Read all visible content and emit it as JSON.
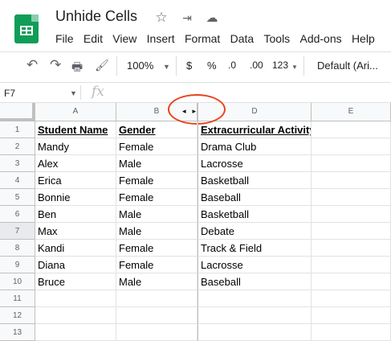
{
  "doc_title": "Unhide Cells",
  "menu": [
    "File",
    "Edit",
    "View",
    "Insert",
    "Format",
    "Data",
    "Tools",
    "Add-ons",
    "Help"
  ],
  "toolbar": {
    "undo": "↶",
    "redo": "↷",
    "print": "🖶",
    "paint": "🖌",
    "zoom": "100%",
    "currency": "$",
    "percent": "%",
    "dec_decrease": ".0",
    "dec_increase": ".00",
    "more_formats": "123",
    "font": "Default (Ari..."
  },
  "formula_bar": {
    "name_box": "F7",
    "fx": "fx",
    "value": ""
  },
  "columns": [
    "A",
    "B",
    "D",
    "E"
  ],
  "hidden_column_arrows": "◂▸",
  "rows": [
    {
      "num": "1",
      "a": "Student Name",
      "b": "Gender",
      "d": "Extracurricular Activity"
    },
    {
      "num": "2",
      "a": "Mandy",
      "b": "Female",
      "d": "Drama Club"
    },
    {
      "num": "3",
      "a": "Alex",
      "b": "Male",
      "d": "Lacrosse"
    },
    {
      "num": "4",
      "a": "Erica",
      "b": "Female",
      "d": "Basketball"
    },
    {
      "num": "5",
      "a": "Bonnie",
      "b": "Female",
      "d": "Baseball"
    },
    {
      "num": "6",
      "a": "Ben",
      "b": "Male",
      "d": "Basketball"
    },
    {
      "num": "7",
      "a": "Max",
      "b": "Male",
      "d": "Debate"
    },
    {
      "num": "8",
      "a": "Kandi",
      "b": "Female",
      "d": "Track & Field"
    },
    {
      "num": "9",
      "a": "Diana",
      "b": "Female",
      "d": "Lacrosse"
    },
    {
      "num": "10",
      "a": "Bruce",
      "b": "Male",
      "d": "Baseball"
    },
    {
      "num": "11",
      "a": "",
      "b": "",
      "d": ""
    },
    {
      "num": "12",
      "a": "",
      "b": "",
      "d": ""
    },
    {
      "num": "13",
      "a": "",
      "b": "",
      "d": ""
    }
  ],
  "colors": {
    "brand_green": "#0f9d58",
    "annotation_red": "#e8431f"
  }
}
